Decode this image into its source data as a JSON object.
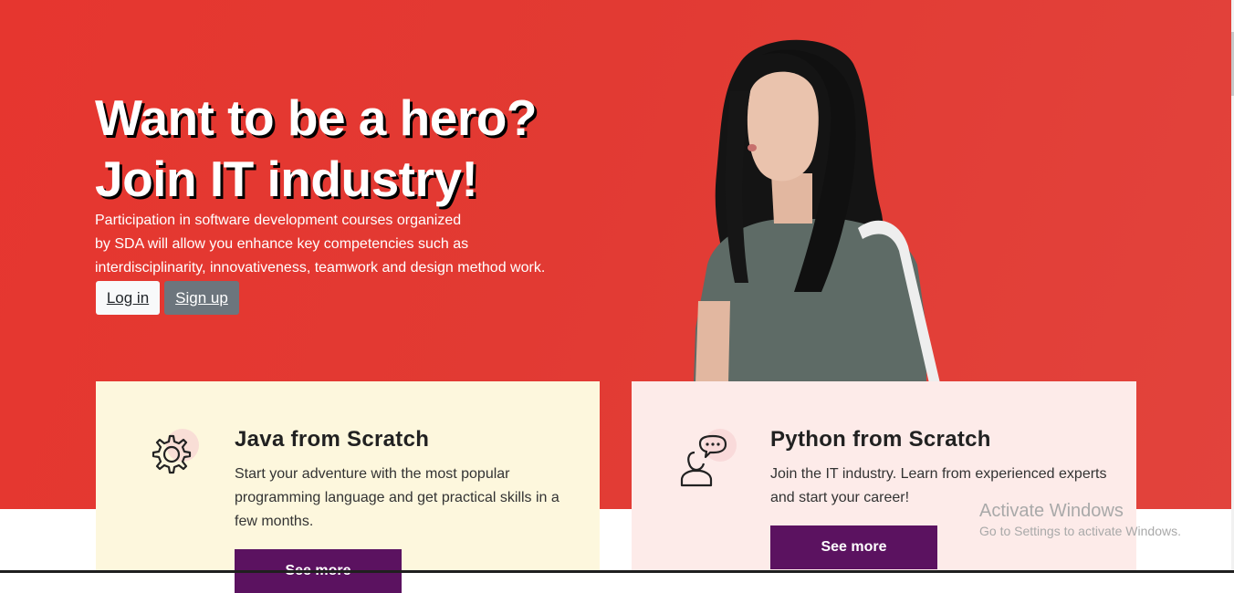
{
  "hero": {
    "title_line1": "Want to be a hero?",
    "title_line2": "Join IT industry!",
    "description_lines": [
      "Participation in software development courses organized",
      "by SDA will allow you enhance key competencies such as",
      "interdisciplinarity, innovativeness, teamwork and design method work."
    ],
    "login_label": "Log in",
    "signup_label": "Sign up",
    "background_color": "#e6362f"
  },
  "cards": [
    {
      "icon": "gear-icon",
      "title": "Java from Scratch",
      "text": "Start your adventure with the most popular programming language and get practical skills in a few months.",
      "button_label": "See more",
      "background_color": "#fdf7dd"
    },
    {
      "icon": "person-chat-icon",
      "title": "Python from Scratch",
      "text": "Join the IT industry. Learn from experienced experts and start your career!",
      "button_label": "See more",
      "background_color": "#fdebe9"
    }
  ],
  "accent_color": "#5b1260",
  "watermark": {
    "title": "Activate Windows",
    "subtitle": "Go to Settings to activate Windows."
  }
}
